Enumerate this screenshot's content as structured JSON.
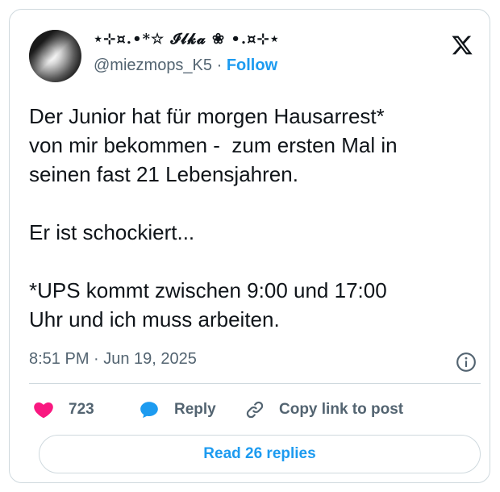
{
  "user": {
    "display_name": "⋆⊹¤.•*☆ 𝓘𝓵𝓴𝓪 ❀ •.¤⊹⋆",
    "handle": "@miezmops_K5",
    "separator": " · ",
    "follow_label": "Follow"
  },
  "tweet": {
    "text": "Der Junior hat für morgen Hausarrest*\nvon mir bekommen -  zum ersten Mal in\nseinen fast 21 Lebensjahren.\n\nEr ist schockiert...\n\n*UPS kommt zwischen 9:00 und 17:00\nUhr und ich muss arbeiten.",
    "timestamp": "8:51 PM · Jun 19, 2025"
  },
  "actions": {
    "like_count": "723",
    "reply_label": "Reply",
    "copy_label": "Copy link to post"
  },
  "footer": {
    "read_replies_label": "Read 26 replies"
  },
  "colors": {
    "like": "#f91880",
    "reply": "#1d9bf0",
    "link": "#1d9bf0",
    "muted": "#536471",
    "border": "#cfd9de"
  },
  "icons": [
    "x-logo-icon",
    "info-icon",
    "heart-icon",
    "reply-bubble-icon",
    "link-icon"
  ]
}
